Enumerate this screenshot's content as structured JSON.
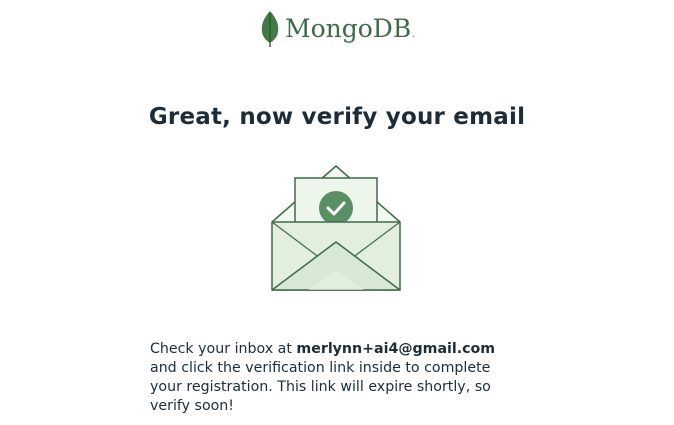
{
  "brand": {
    "name": "MongoDB",
    "mark": ".",
    "color": "#3d6b48"
  },
  "headline": "Great, now verify your email",
  "illustration": {
    "icon": "envelope-with-check-icon",
    "accent": "#5a8f63"
  },
  "message": {
    "prefix": "Check your inbox at ",
    "email": "merlynn+ai4@gmail.com",
    "suffix": " and click the verification link inside to complete your registration. This link will expire shortly, so verify soon!"
  }
}
